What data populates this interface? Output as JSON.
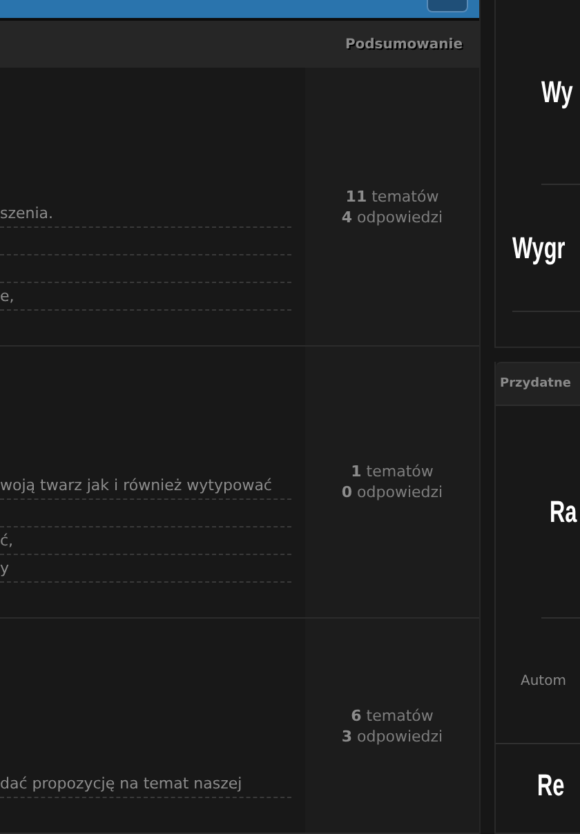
{
  "header": {
    "summary_label": "Podsumowanie"
  },
  "forums": [
    {
      "lines": [
        {
          "kind": "text",
          "text": "szenia."
        },
        {
          "kind": "spacer"
        },
        {
          "kind": "spacer"
        },
        {
          "kind": "text",
          "text": "e,"
        }
      ],
      "topics_count": "11",
      "topics_label": "tematów",
      "replies_count": "4",
      "replies_label": "odpowiedzi"
    },
    {
      "lines": [
        {
          "kind": "text",
          "text": "woją twarz jak i również wytypować"
        },
        {
          "kind": "spacer"
        },
        {
          "kind": "text",
          "text": "ć,"
        },
        {
          "kind": "text",
          "text": "y"
        }
      ],
      "topics_count": "1",
      "topics_label": "tematów",
      "replies_count": "0",
      "replies_label": "odpowiedzi"
    },
    {
      "lines": [
        {
          "kind": "text",
          "text": "dać propozycję na temat naszej"
        }
      ],
      "topics_count": "6",
      "topics_label": "tematów",
      "replies_count": "3",
      "replies_label": "odpowiedzi"
    }
  ],
  "sidebar": {
    "panel_1": {
      "banners": [
        "Wy",
        "Wygr"
      ]
    },
    "panel_2": {
      "title": "Przydatne",
      "banner": "Ra",
      "caption": "Autom",
      "banner_2": "Re"
    }
  }
}
